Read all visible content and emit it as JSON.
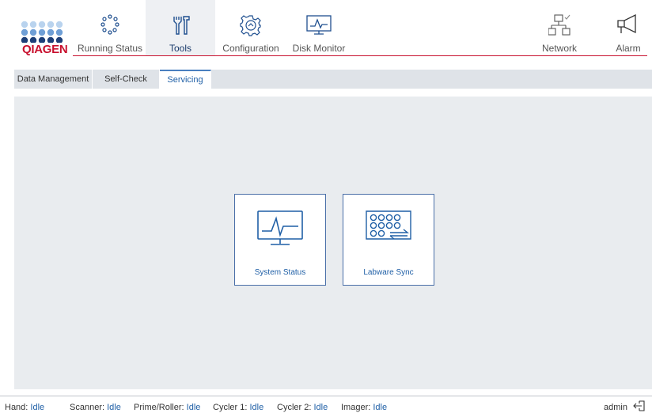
{
  "brand": {
    "name": "QIAGEN",
    "color": "#c8102e"
  },
  "nav": {
    "running_status": "Running Status",
    "tools": "Tools",
    "configuration": "Configuration",
    "disk_monitor": "Disk Monitor",
    "network": "Network",
    "alarm": "Alarm",
    "active": "Tools"
  },
  "subtabs": {
    "data_management": "Data Management",
    "self_check": "Self-Check",
    "servicing": "Servicing",
    "active": "Servicing"
  },
  "cards": {
    "system_status": "System Status",
    "labware_sync": "Labware Sync"
  },
  "status": {
    "hand_k": "Hand:",
    "hand_v": "Idle",
    "scanner_k": "Scanner:",
    "scanner_v": "Idle",
    "prime_k": "Prime/Roller:",
    "prime_v": "Idle",
    "cycler1_k": "Cycler 1:",
    "cycler1_v": "Idle",
    "cycler2_k": "Cycler 2:",
    "cycler2_v": "Idle",
    "imager_k": "Imager:",
    "imager_v": "Idle"
  },
  "user": "admin",
  "colors": {
    "accent": "#1f5fa6",
    "brand_red": "#c8102e",
    "panel": "#e9ecef"
  }
}
